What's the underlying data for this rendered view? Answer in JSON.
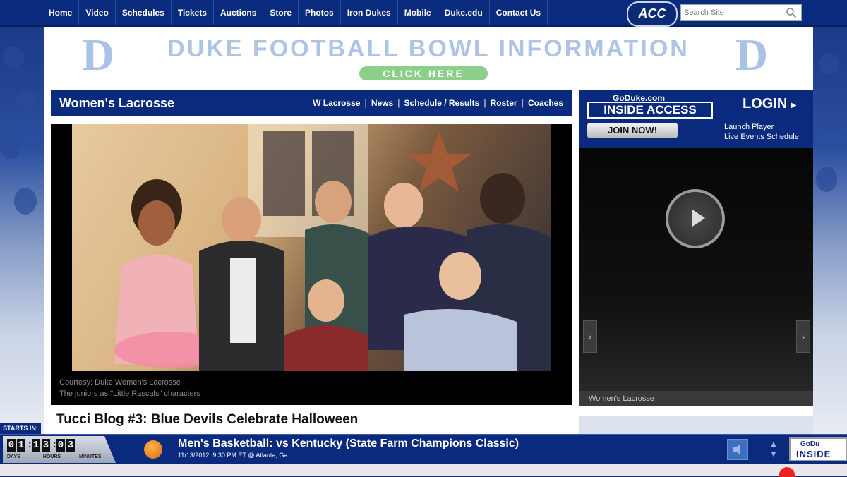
{
  "nav": {
    "items": [
      "Home",
      "Video",
      "Schedules",
      "Tickets",
      "Auctions",
      "Store",
      "Photos",
      "Iron Dukes",
      "Mobile",
      "Duke.edu",
      "Contact Us"
    ],
    "acc_logo": "ACC",
    "search_placeholder": "Search Site"
  },
  "banner": {
    "title": "DUKE FOOTBALL BOWL INFORMATION",
    "cta": "CLICK HERE",
    "logo_letter": "D"
  },
  "sport": {
    "name": "Women's Lacrosse",
    "links": [
      "W Lacrosse",
      "News",
      "Schedule / Results",
      "Roster",
      "Coaches"
    ]
  },
  "photo": {
    "credit": "Courtesy: Duke Women's Lacrosse",
    "caption": "The juniors as \"Little Rascals\" characters"
  },
  "article": {
    "headline": "Tucci Blog #3: Blue Devils Celebrate Halloween"
  },
  "inside_access": {
    "brand": "GoDuke.com",
    "title": "INSIDE ACCESS",
    "login": "LOGIN",
    "join": "JOIN NOW!",
    "link1": "Launch Player",
    "link2": "Live Events Schedule"
  },
  "player": {
    "caption": "Women's Lacrosse"
  },
  "ticker": {
    "starts_in": "STARTS IN:",
    "digits": [
      "0",
      "1",
      "1",
      "3",
      "0",
      "3"
    ],
    "units": [
      "DAYS",
      "HOURS",
      "MINUTES"
    ],
    "game": "Men's Basketball: vs Kentucky (State Farm Champions Classic)",
    "date": "11/13/2012, 9:30 PM ET @ Atlanta, Ga.",
    "corner_brand": "GoDu",
    "corner_title": "INSIDE"
  },
  "colors": {
    "duke_blue": "#0a2a7d",
    "banner_light_blue": "#aec4e4",
    "cta_green": "#8ccf8a"
  }
}
